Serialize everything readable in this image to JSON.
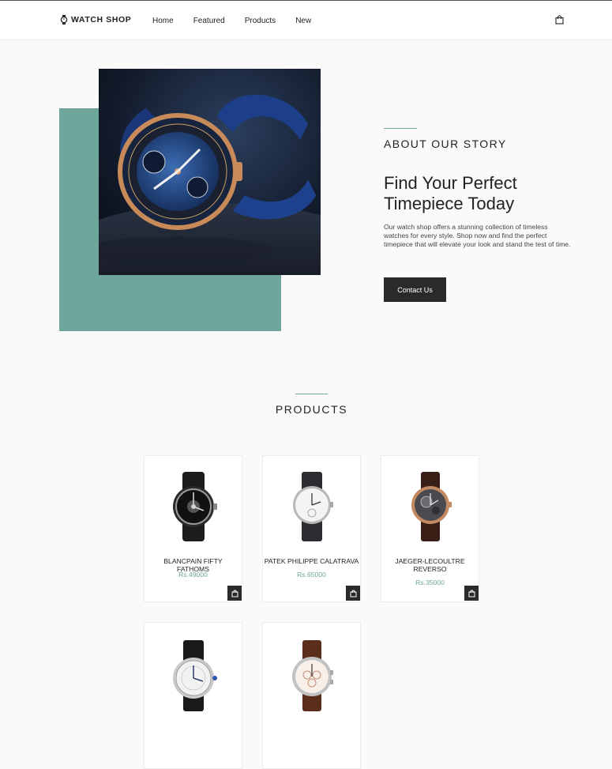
{
  "nav": {
    "brand": "WATCH SHOP",
    "links": [
      "Home",
      "Featured",
      "Products",
      "New"
    ]
  },
  "about": {
    "kicker": "ABOUT OUR STORY",
    "title": "Find Your Perfect Timepiece Today",
    "text": "Our watch shop offers a stunning collection of timeless watches for every style. Shop now and find the perfect timepiece that will elevate your look and stand the test of time.",
    "button": "Contact Us"
  },
  "products": {
    "heading": "PRODUCTS",
    "items": [
      {
        "name": "BLANCPAIN FIFTY FATHOMS",
        "price": "Rs.49000"
      },
      {
        "name": "PATEK PHILIPPE CALATRAVA",
        "price": "Rs.65000"
      },
      {
        "name": "JAEGER-LECOULTRE REVERSO",
        "price": "Rs.35000"
      },
      {
        "name": "",
        "price": ""
      },
      {
        "name": "",
        "price": ""
      }
    ]
  },
  "colors": {
    "accent": "#6fa69c",
    "dark": "#2a2a2a"
  }
}
